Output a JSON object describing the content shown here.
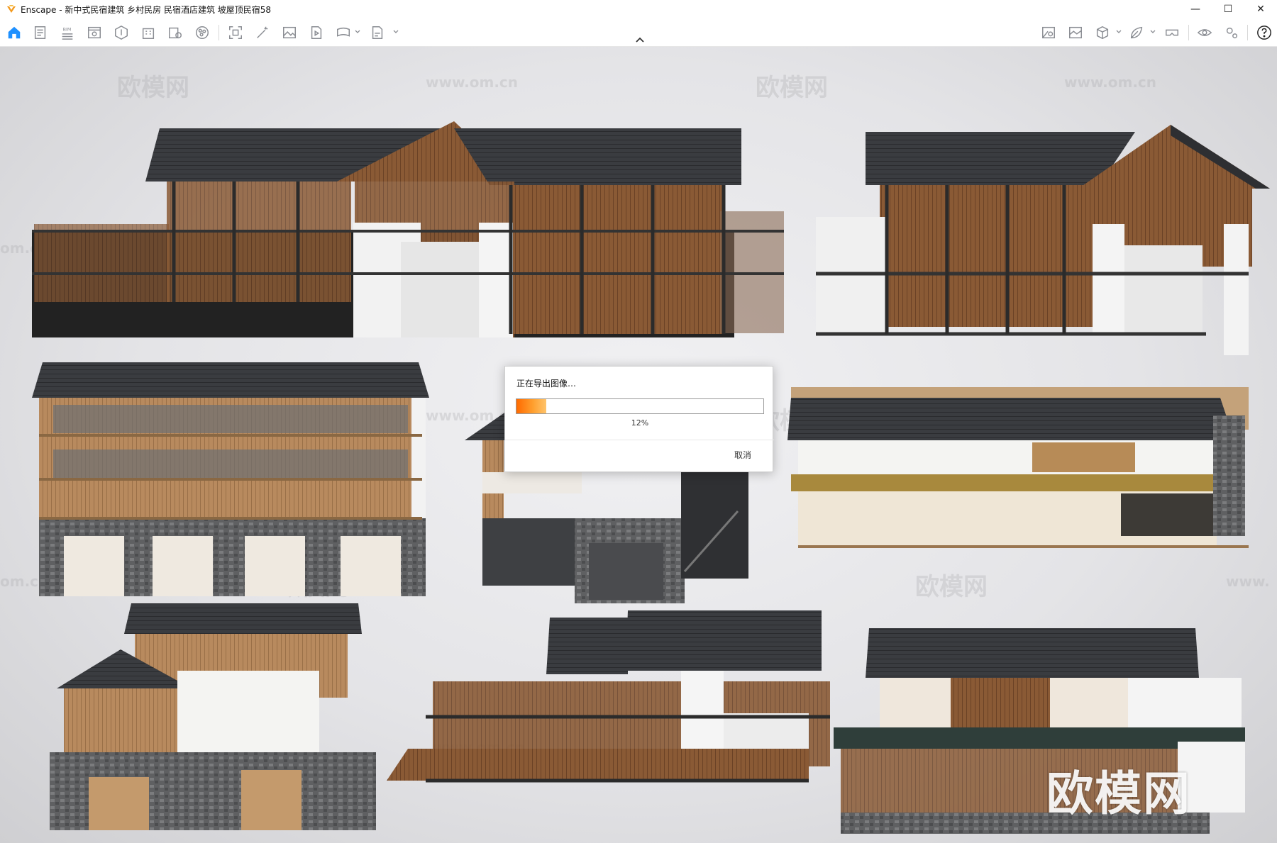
{
  "window": {
    "title": "Enscape - 新中式民宿建筑 乡村民房 民宿酒店建筑 坡屋顶民宿58",
    "controls": {
      "minimize": "—",
      "maximize": "☐",
      "close": "✕"
    }
  },
  "toolbar": {
    "left_icons": [
      "home-icon",
      "document-icon",
      "bim-info-icon",
      "view-icon",
      "asset-library-icon",
      "building-icon",
      "object-info-icon",
      "material-icon",
      "screenshot-icon",
      "magic-wand-icon",
      "image-icon",
      "video-icon",
      "panorama-icon",
      "export-icon"
    ],
    "right_icons": [
      "atmosphere-icon",
      "visual-settings-icon",
      "cube-icon",
      "leaf-icon",
      "vr-headset-icon",
      "eye-icon",
      "settings-icon",
      "help-icon"
    ],
    "accent_color": "#1e90ff"
  },
  "dialog": {
    "title": "正在导出图像…",
    "progress_percent": 12,
    "progress_label": "12%",
    "cancel_label": "取消"
  },
  "watermarks": {
    "brand": "欧模网",
    "url": "www.om.cn",
    "partial_url": "om.cn",
    "partial_url_right": "www."
  }
}
